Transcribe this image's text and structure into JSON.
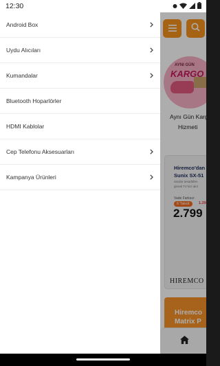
{
  "status_bar": {
    "time": "12:30"
  },
  "drawer": {
    "items": [
      {
        "label": "Android Box",
        "has_chevron": true
      },
      {
        "label": "Uydu Alıcıları",
        "has_chevron": true
      },
      {
        "label": "Kumandalar",
        "has_chevron": true
      },
      {
        "label": "Bluetooth Hoparlörler",
        "has_chevron": false
      },
      {
        "label": "HDMI Kablolar",
        "has_chevron": false
      },
      {
        "label": "Cep Telefonu Aksesuarları",
        "has_chevron": true
      },
      {
        "label": "Kampanya Ürünleri",
        "has_chevron": true
      }
    ]
  },
  "background": {
    "promo_circle": {
      "small_text": "AYNI GÜN",
      "big_text": "KARGO"
    },
    "caption_line1": "Aynı Gün Kargo",
    "caption_line2": "Hizmeti",
    "product_card": {
      "title_line1": "Hiremco'dan",
      "title_line2": "Sunix SX-51",
      "desc_line1": "Sürdür tesadüfen",
      "desc_line2": "gimek TV'nizi akıl",
      "vade_label": "Vade Farksız:",
      "taksit": "6 Taksit",
      "small_price": "1.29",
      "price": "2.799"
    },
    "brand": "HIREMCO",
    "promo_banner": {
      "line1": "Hiremco",
      "line2": "Matrix P"
    }
  },
  "colors": {
    "accent": "#f7931e",
    "drawer_bg": "#ffffff",
    "divider": "#ececec"
  },
  "icons": {
    "status": [
      "notification-icon",
      "wifi-icon",
      "signal-icon",
      "battery-icon"
    ],
    "menu": "hamburger-icon",
    "search": "search-icon",
    "chevron": "chevron-right-icon",
    "home": "home-icon"
  }
}
